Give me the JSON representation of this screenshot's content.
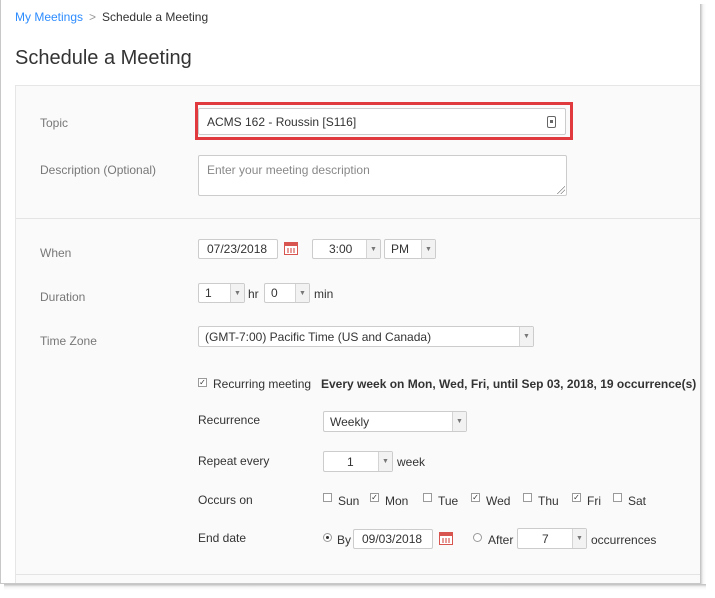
{
  "breadcrumb": {
    "link": "My Meetings",
    "separator": ">",
    "current": "Schedule a Meeting"
  },
  "page_title": "Schedule a Meeting",
  "form": {
    "topic": {
      "label": "Topic",
      "value": "ACMS 162 - Roussin [S116]"
    },
    "description": {
      "label": "Description (Optional)",
      "placeholder": "Enter your meeting description"
    },
    "when": {
      "label": "When",
      "date": "07/23/2018",
      "time": "3:00",
      "ampm": "PM"
    },
    "duration": {
      "label": "Duration",
      "hours": "1",
      "hr_unit": "hr",
      "minutes": "0",
      "min_unit": "min"
    },
    "time_zone": {
      "label": "Time Zone",
      "value": "(GMT-7:00) Pacific Time (US and Canada)"
    },
    "recurring": {
      "checked": true,
      "label": "Recurring meeting",
      "summary": "Every week on Mon, Wed, Fri, until Sep 03, 2018, 19 occurrence(s)",
      "recurrence": {
        "label": "Recurrence",
        "value": "Weekly"
      },
      "repeat_every": {
        "label": "Repeat every",
        "value": "1",
        "unit": "week"
      },
      "occurs_on": {
        "label": "Occurs on",
        "days": [
          {
            "name": "Sun",
            "checked": false
          },
          {
            "name": "Mon",
            "checked": true
          },
          {
            "name": "Tue",
            "checked": false
          },
          {
            "name": "Wed",
            "checked": true
          },
          {
            "name": "Thu",
            "checked": false
          },
          {
            "name": "Fri",
            "checked": true
          },
          {
            "name": "Sat",
            "checked": false
          }
        ]
      },
      "end_date": {
        "label": "End date",
        "by_label": "By",
        "by_date": "09/03/2018",
        "after_label": "After",
        "occurrences": "7",
        "occurrences_unit": "occurrences",
        "selected": "by"
      }
    }
  },
  "colors": {
    "link": "#2d8cff",
    "highlight": "#e0393e",
    "calendar": "#d8544f"
  },
  "icons": [
    "calendar-icon",
    "chevron-down-icon",
    "checkmark-icon",
    "keyboard-icon",
    "resize-handle-icon"
  ]
}
